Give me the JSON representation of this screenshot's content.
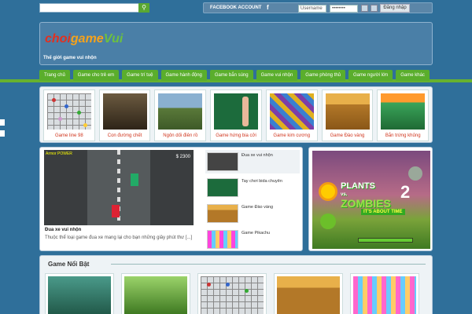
{
  "top": {
    "search_placeholder": "",
    "facebook_label": "FACEBOOK ACCOUNT",
    "username_placeholder": "Username",
    "password_placeholder": "••••••••",
    "login_label": "Đăng nhập"
  },
  "header": {
    "logo": {
      "part1": "choi",
      "part2": "game",
      "part3": "Vui"
    },
    "tagline": "Thế giới game vui nhộn"
  },
  "nav": [
    "Trang chủ",
    "Game cho trẻ em",
    "Game trí tuệ",
    "Game hành động",
    "Game bắn súng",
    "Game vui nhộn",
    "Game phòng thủ",
    "Game người lớn",
    "Game khác"
  ],
  "top_games": [
    {
      "label": "Game line 98",
      "icon": "lines-board"
    },
    {
      "label": "Con đường chết",
      "icon": "dark-road"
    },
    {
      "label": "Ngôn dối điên rồ",
      "icon": "racing-car"
    },
    {
      "label": "Game hứng bia cởi",
      "icon": "pool-table"
    },
    {
      "label": "Game kim cương",
      "icon": "jewels"
    },
    {
      "label": "Game Đào vàng",
      "icon": "gold-miner"
    },
    {
      "label": "Bắn trứng khủng",
      "icon": "dinosaur-bubble"
    }
  ],
  "feature": {
    "hud_left": "Armor\nPOWER",
    "hud_right": "$ 2300",
    "title": "Đua xe vui nhộn",
    "desc": "Thuộc thể loại game đua xe mang lại cho bạn những giây phút thư [...]",
    "list": [
      {
        "label": "Đua xe vui nhộn"
      },
      {
        "label": "Tay chơi bida chuyên"
      },
      {
        "label": "Game Đào vàng"
      },
      {
        "label": "Game Pikachu"
      }
    ]
  },
  "banner": {
    "title_a": "PLANTS",
    "title_vs": "vs.",
    "title_b": "ZOMBIES",
    "number": "2",
    "subtitle": "IT'S ABOUT TIME"
  },
  "featured": {
    "title": "Game Nổi Bật",
    "thumbs": [
      "game-over",
      "plants-vs-zombies",
      "lines-board",
      "gold-miner",
      "pikachu"
    ]
  },
  "colors": {
    "background": "#2f6f9a",
    "nav_green": "#5aae2c",
    "label_red": "#d0341c"
  }
}
